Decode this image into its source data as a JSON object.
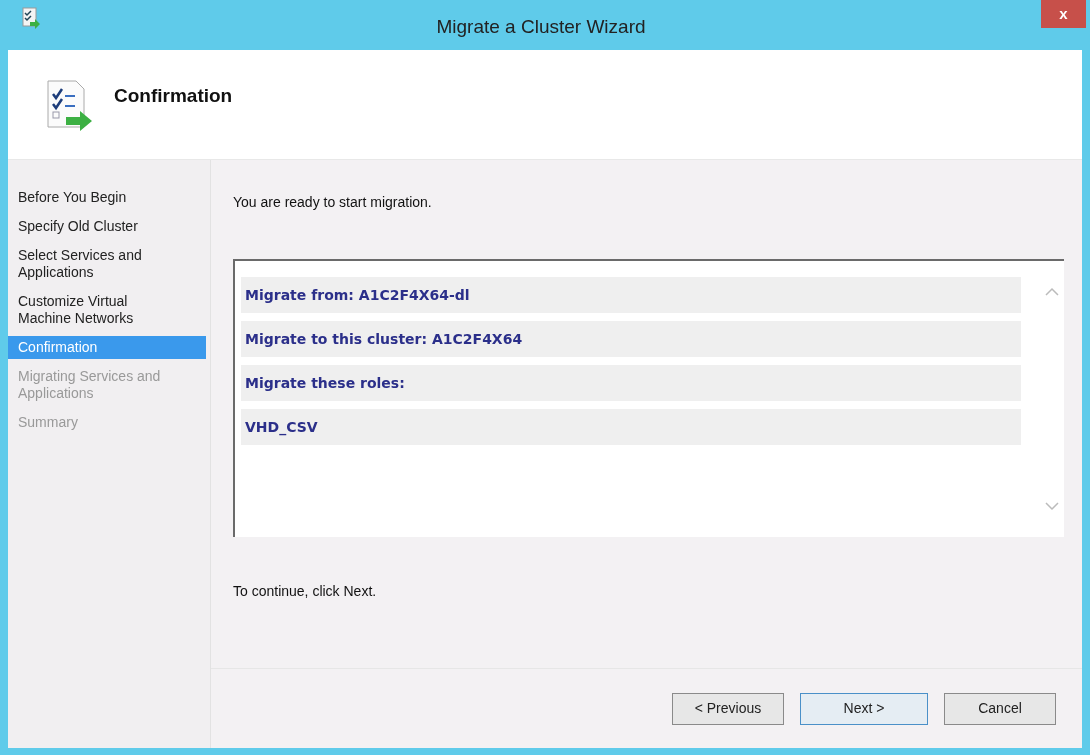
{
  "window": {
    "title": "Migrate a Cluster Wizard",
    "close": "x"
  },
  "header": {
    "title": "Confirmation"
  },
  "steps": [
    {
      "label": "Before You Begin",
      "selected": false,
      "disabled": false
    },
    {
      "label": "Specify Old Cluster",
      "selected": false,
      "disabled": false
    },
    {
      "label": "Select Services and Applications",
      "selected": false,
      "disabled": false
    },
    {
      "label": "Customize Virtual Machine Networks",
      "selected": false,
      "disabled": false
    },
    {
      "label": "Confirmation",
      "selected": true,
      "disabled": false
    },
    {
      "label": "Migrating Services and Applications",
      "selected": false,
      "disabled": true
    },
    {
      "label": "Summary",
      "selected": false,
      "disabled": true
    }
  ],
  "intro": "You are ready to start migration.",
  "summary_lines": [
    "Migrate from: A1C2F4X64-dl",
    "Migrate to this cluster: A1C2F4X64",
    "Migrate these roles:",
    "VHD_CSV"
  ],
  "footer_text": "To continue, click Next.",
  "buttons": [
    {
      "label": "< Previous",
      "default": false
    },
    {
      "label": "Next >",
      "default": true
    },
    {
      "label": "Cancel",
      "default": false
    }
  ]
}
